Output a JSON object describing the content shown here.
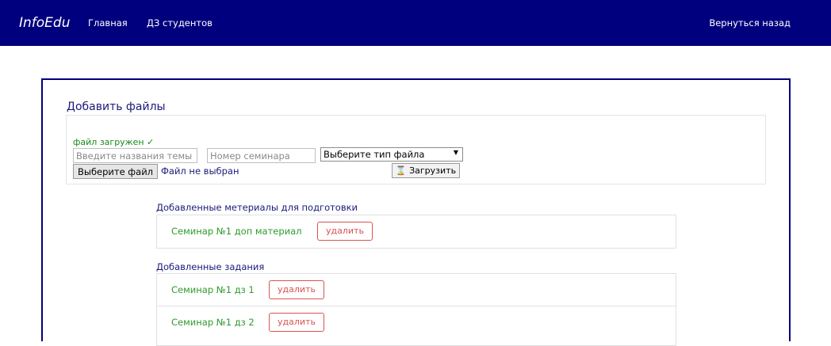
{
  "nav": {
    "brand": "InfoEdu",
    "home": "Главная",
    "student_hw": "ДЗ студентов",
    "back": "Вернуться назад"
  },
  "upload": {
    "title": "Добавить файлы",
    "status": "файл загружен ✓",
    "topic_placeholder": "Введите названия темы",
    "seminar_placeholder": "Номер семинара",
    "file_type_selected": "Выберите тип файла",
    "choose_file_label": "Выберите файл",
    "no_file_label": "Файл не выбран",
    "upload_label": "⌛ Загрузить"
  },
  "materials": {
    "title": "Добавленные метериалы для подготовки",
    "items": [
      {
        "name": "Семинар №1 доп материал",
        "delete_label": "удалить"
      }
    ]
  },
  "tasks": {
    "title": "Добавленные задания",
    "items": [
      {
        "name": "Семинар №1 дз 1",
        "delete_label": "удалить"
      },
      {
        "name": "Семинар №1 дз 2",
        "delete_label": "удалить"
      }
    ]
  },
  "colors": {
    "navbar": "#00007f",
    "success": "#2e9a2e",
    "danger": "#d9534f"
  }
}
